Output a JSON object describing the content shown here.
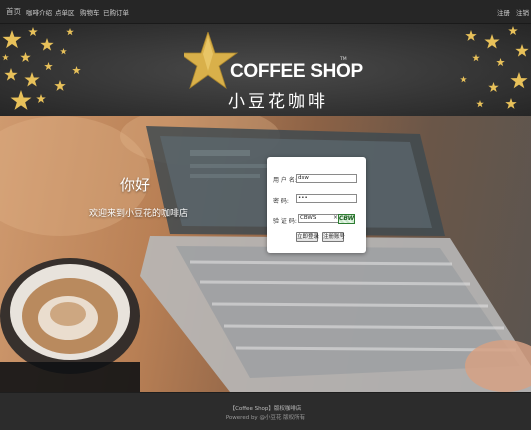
{
  "nav": {
    "home": "首页",
    "items": [
      "咖啡介绍",
      "点单区",
      "购物车",
      "已购订单"
    ],
    "register": "注册",
    "logout": "注销"
  },
  "brand": {
    "name_en": "COFFEE SHOP",
    "tm": "TM",
    "name_cn": "小豆花咖啡"
  },
  "hero": {
    "greeting": "你好",
    "welcome": "欢迎来到小豆花的咖啡店"
  },
  "login": {
    "username_label": "用 户 名:",
    "username_value": "dsw",
    "password_label": "密    码:",
    "password_value": "•••",
    "captcha_label": "验 证 码:",
    "captcha_value": "CBWS",
    "clear_glyph": "×",
    "captcha_image_text": "CBWS",
    "login_button": "立即登录",
    "register_button": "注册账号"
  },
  "footer": {
    "line1": "【Coffee Shop】版权咖啡店",
    "line2": "Powered by @小豆花 版权所有"
  },
  "colors": {
    "nav_bg": "#262626",
    "banner_bg": "#3a3a3a",
    "star_gold": "#e8c15a",
    "footer_bg": "#2c2c2c",
    "card_bg": "#ffffff"
  }
}
